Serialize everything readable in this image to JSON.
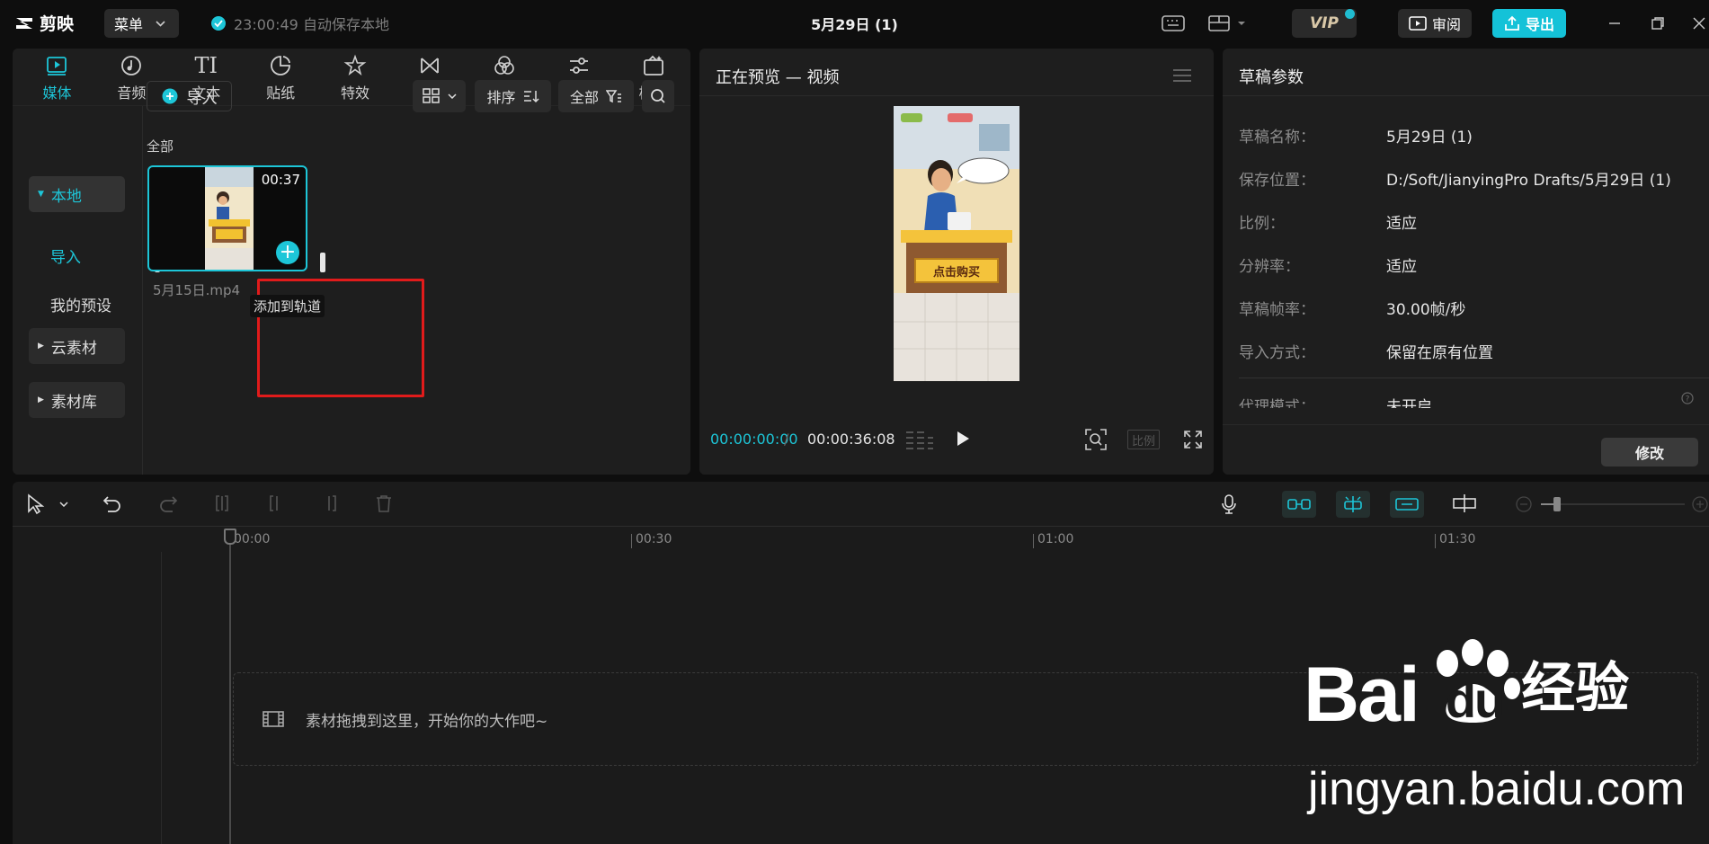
{
  "app": {
    "name": "剪映",
    "menu_label": "菜单",
    "autosave": "23:00:49 自动保存本地",
    "project_title": "5月29日 (1)"
  },
  "topbar": {
    "vip": "VIP",
    "review": "审阅",
    "export": "导出"
  },
  "media_tabs": [
    {
      "label": "媒体",
      "icon": "media-icon",
      "active": true
    },
    {
      "label": "音频",
      "icon": "audio-icon"
    },
    {
      "label": "文本",
      "icon": "text-icon",
      "glyph": "TI"
    },
    {
      "label": "贴纸",
      "icon": "sticker-icon"
    },
    {
      "label": "特效",
      "icon": "effects-icon"
    },
    {
      "label": "转场",
      "icon": "transition-icon"
    },
    {
      "label": "滤镜",
      "icon": "filter-icon"
    },
    {
      "label": "调节",
      "icon": "adjust-icon"
    },
    {
      "label": "模板",
      "icon": "template-icon"
    }
  ],
  "left_nav": {
    "local": "本地",
    "import": "导入",
    "my_presets": "我的预设",
    "cloud": "云素材",
    "library": "素材库"
  },
  "media": {
    "import_btn": "导入",
    "sort": "排序",
    "filter_all": "全部",
    "section": "全部",
    "clip_duration": "00:37",
    "clip_name": "5月15日.mp4",
    "tooltip": "添加到轨道",
    "poster_button_text": "点击购买"
  },
  "preview": {
    "title": "正在预览 — 视频",
    "current_time": "00:00:00:00",
    "total_time": "00:00:36:08",
    "ratio": "比例"
  },
  "params": {
    "title": "草稿参数",
    "rows": [
      {
        "key": "草稿名称：",
        "value": "5月29日 (1)"
      },
      {
        "key": "保存位置：",
        "value": "D:/Soft/JianyingPro Drafts/5月29日 (1)"
      },
      {
        "key": "比例：",
        "value": "适应"
      },
      {
        "key": "分辨率：",
        "value": "适应"
      },
      {
        "key": "草稿帧率：",
        "value": "30.00帧/秒"
      },
      {
        "key": "导入方式：",
        "value": "保留在原有位置"
      },
      {
        "key": "代理模式：",
        "value": "未开启"
      }
    ],
    "modify": "修改"
  },
  "timeline": {
    "ruler": [
      "00:00",
      "00:30",
      "01:00",
      "01:30"
    ],
    "drop_hint": "素材拖拽到这里，开始你的大作吧~"
  },
  "watermark": {
    "brand": "Bai",
    "brand2": "du",
    "brand_cn": "经验",
    "url": "jingyan.baidu.com"
  },
  "colors": {
    "accent": "#1dc6d8",
    "highlight_box": "#e11b1b",
    "panel_bg": "#1e1e1e"
  }
}
